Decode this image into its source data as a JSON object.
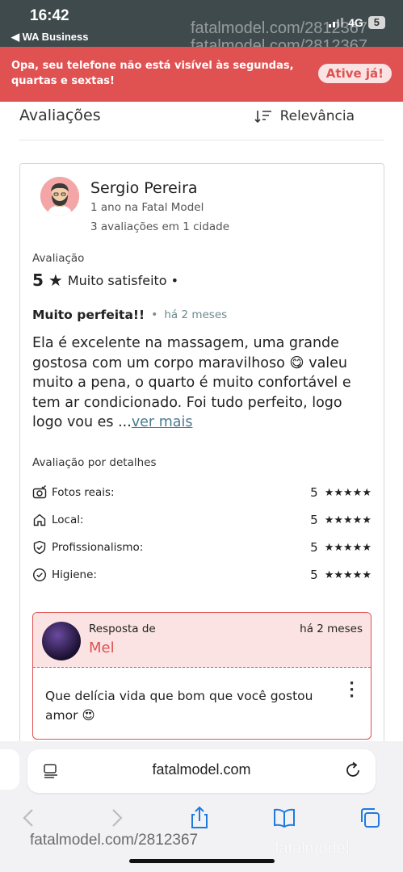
{
  "status_bar": {
    "time": "16:42",
    "back_app": "◀ WA Business",
    "network": "4G",
    "battery": "5"
  },
  "watermark": {
    "top_lines": [
      "fatalmodel.com/2812367",
      "fatalmodel.com/2812367"
    ],
    "bottom": "fatalmodel.com/2812367",
    "logo": "fatalmodel"
  },
  "banner": {
    "text": "Opa, seu telefone não está visível às segundas, quartas e sextas!",
    "button": "Ative já!"
  },
  "reviews_header": {
    "title": "Avaliações",
    "sort_label": "Relevância"
  },
  "review": {
    "name": "Sergio Pereira",
    "member_since": "1 ano na Fatal Model",
    "stats": "3 avaliações em 1 cidade",
    "rating_label": "Avaliação",
    "rating_value": "5",
    "rating_star": "★",
    "rating_text": "Muito satisfeito •",
    "title": "Muito perfeita!!",
    "when": "há 2 meses",
    "body": "Ela é excelente na massagem, uma grande gostosa com um corpo maravilhoso 😋 valeu muito a pena, o quarto é muito confortável e tem ar condicionado. Foi tudo perfeito, logo logo vou es ...",
    "more": "ver mais",
    "details_label": "Avaliação por detalhes",
    "details": [
      {
        "name": "Fotos reais:",
        "score": "5",
        "stars": "★★★★★",
        "icon": "camera-check-icon"
      },
      {
        "name": "Local:",
        "score": "5",
        "stars": "★★★★★",
        "icon": "home-icon"
      },
      {
        "name": "Profissionalismo:",
        "score": "5",
        "stars": "★★★★★",
        "icon": "shield-check-icon"
      },
      {
        "name": "Higiene:",
        "score": "5",
        "stars": "★★★★★",
        "icon": "check-circle-icon"
      }
    ]
  },
  "reply": {
    "label": "Resposta de",
    "name": "Mel",
    "when": "há 2 meses",
    "text": "Que delícia vida que bom que você gostou amor 😍",
    "menu": "⋮"
  },
  "browser": {
    "url": "fatalmodel.com"
  },
  "colors": {
    "accent": "#e05252",
    "accent_light": "#fbe3e3",
    "status_bar": "#3f4a4d",
    "link": "#4a7a92"
  }
}
